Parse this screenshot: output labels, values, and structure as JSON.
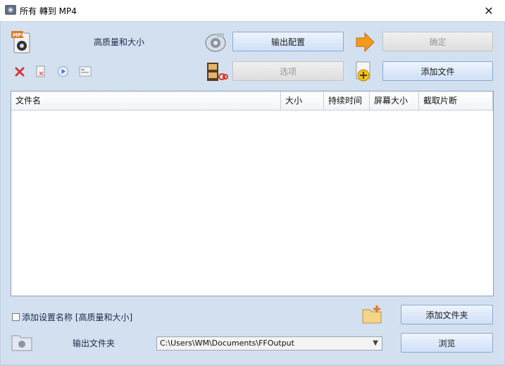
{
  "window": {
    "title": "所有 轉到 MP4",
    "close_label": "✕"
  },
  "header": {
    "profile_label": "高质量和大小"
  },
  "buttons": {
    "output_config": "输出配置",
    "ok": "确定",
    "options": "选项",
    "add_file": "添加文件",
    "add_folder": "添加文件夹",
    "browse": "浏览"
  },
  "icons": {
    "mp4_format": "mp4-film-icon",
    "output_config": "speaker-settings-icon",
    "ok_arrow": "orange-arrow-icon",
    "remove": "red-x-icon",
    "clear": "clear-list-icon",
    "play": "play-icon",
    "info": "media-info-icon",
    "options": "film-scissors-icon",
    "add_file": "add-file-plus-icon",
    "add_folder": "folder-plus-icon",
    "output_folder": "folder-icon"
  },
  "file_list": {
    "columns": [
      "文件名",
      "大小",
      "持续时间",
      "屏幕大小",
      "截取片断"
    ],
    "rows": []
  },
  "footer": {
    "append_setting_label": "添加设置名称 [高质量和大小]",
    "append_setting_checked": false,
    "output_folder_label": "输出文件夹",
    "output_path": "C:\\Users\\WM\\Documents\\FFOutput"
  },
  "colors": {
    "accent_orange": "#f39a1a",
    "remove_red": "#d23a3a",
    "client_bg": "#d3e0f0"
  }
}
